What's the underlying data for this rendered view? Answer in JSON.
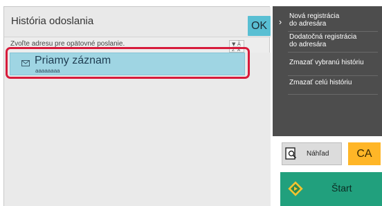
{
  "header": {
    "title": "História odoslania",
    "ok_label": "OK"
  },
  "instruction": "Zvoľte adresu pre opätovné poslanie.",
  "sort_icon_text": "▼\nĀ",
  "list": {
    "items": [
      {
        "title": "Priamy záznam",
        "subtitle": "aaaaaaaa",
        "icon": "envelope-icon",
        "selected": true
      }
    ]
  },
  "side_menu": {
    "items": [
      {
        "label": "Nová registrácia\ndo adresára"
      },
      {
        "label": "Dodatočná registrácia\ndo adresára"
      },
      {
        "label": "Zmazať vybranú históriu"
      },
      {
        "label": "Zmazať celú históriu"
      }
    ]
  },
  "preview": {
    "label": "Náhľad",
    "icon": "preview-icon"
  },
  "ca": {
    "label": "CA"
  },
  "start": {
    "label": "Štart",
    "icon": "start-diamond-icon"
  },
  "colors": {
    "ok_button": "#59bfd3",
    "selected_row": "#9fd5e3",
    "highlight_ring": "#d71b3b",
    "side_menu": "#4d4d4d",
    "ca_button": "#ffb627",
    "start_button": "#21a07d"
  }
}
